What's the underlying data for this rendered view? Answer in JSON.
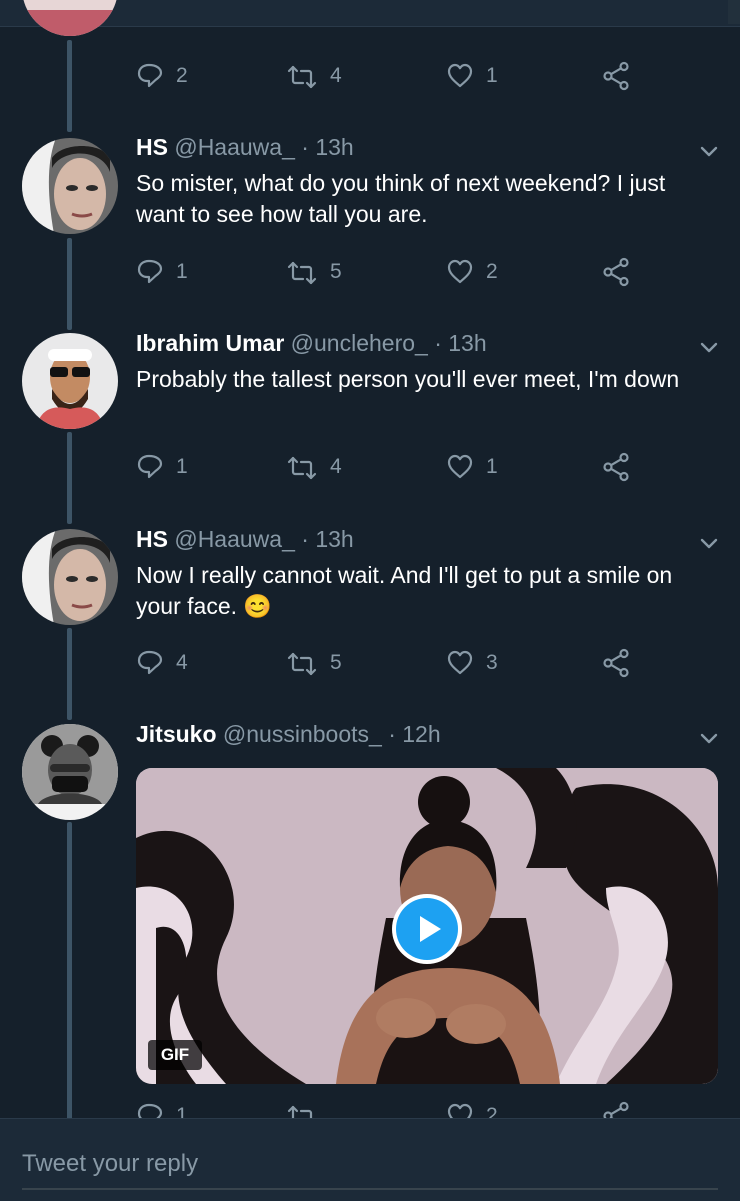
{
  "tweets": [
    {
      "stats": {
        "replies": "2",
        "retweets": "4",
        "likes": "1"
      }
    },
    {
      "name": "HS",
      "handle": "@Haauwa_",
      "time": "· 13h",
      "text": "So mister, what do you think of next weekend? I just want to see how tall you are.",
      "stats": {
        "replies": "1",
        "retweets": "5",
        "likes": "2"
      }
    },
    {
      "name": "Ibrahim Umar",
      "handle": "@unclehero_",
      "time": "· 13h",
      "text": "Probably the tallest person you'll ever meet, I'm down",
      "stats": {
        "replies": "1",
        "retweets": "4",
        "likes": "1"
      }
    },
    {
      "name": "HS",
      "handle": "@Haauwa_",
      "time": "· 13h",
      "text": "Now I really cannot wait. And I'll get to put a smile on your face. 😊",
      "stats": {
        "replies": "4",
        "retweets": "5",
        "likes": "3"
      }
    },
    {
      "name": "Jitsuko",
      "handle": "@nussinboots_",
      "time": "· 12h",
      "media_badge": "GIF",
      "stats": {
        "replies": "1",
        "retweets": "",
        "likes": "2"
      }
    }
  ],
  "reply": {
    "placeholder": "Tweet your reply"
  },
  "colors": {
    "background": "#15202b",
    "muted": "#8899a6",
    "accent": "#1da1f2",
    "thread_line": "#3d5466"
  },
  "icons": [
    "reply-icon",
    "retweet-icon",
    "like-icon",
    "share-icon",
    "chevron-down-icon",
    "play-icon"
  ]
}
